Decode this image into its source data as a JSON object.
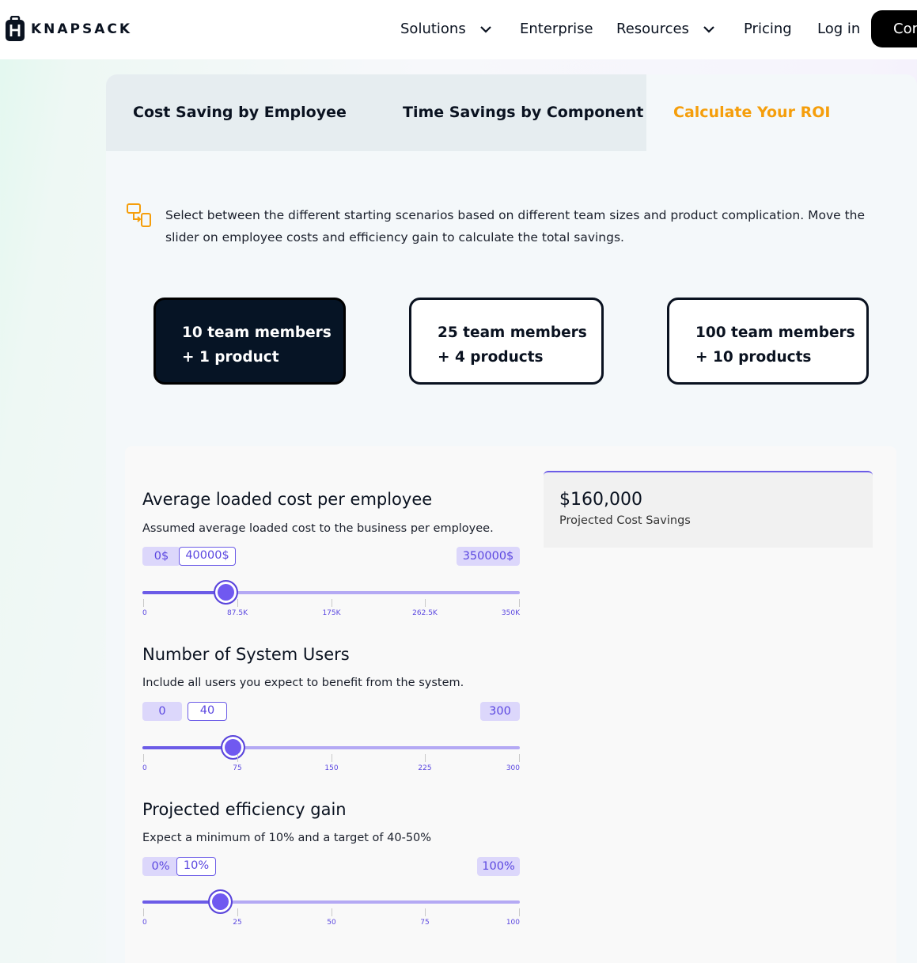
{
  "nav": {
    "brand": "KNAPSACK",
    "items": [
      {
        "label": "Solutions",
        "has_dropdown": true
      },
      {
        "label": "Enterprise",
        "has_dropdown": false
      },
      {
        "label": "Resources",
        "has_dropdown": true
      },
      {
        "label": "Pricing",
        "has_dropdown": false
      },
      {
        "label": "Log in",
        "has_dropdown": false
      }
    ],
    "cta_label": "Cor"
  },
  "tabs": [
    {
      "label": "Cost Saving by Employee",
      "active": false
    },
    {
      "label": "Time Savings by Component",
      "active": false
    },
    {
      "label": "Calculate Your ROI",
      "active": true
    }
  ],
  "intro": {
    "icon": "components-icon",
    "text": "Select between the different starting scenarios based on different team sizes and product complication. Move the slider on employee costs and efficiency gain to calculate the total savings."
  },
  "scenarios": [
    {
      "line1": "10 team members",
      "line2": "+ 1 product",
      "selected": true
    },
    {
      "line1": "25 team members",
      "line2": "+ 4 products",
      "selected": false
    },
    {
      "line1": "100 team members",
      "line2": "+ 10 products",
      "selected": false
    }
  ],
  "result": {
    "value": "$160,000",
    "label": "Projected Cost Savings"
  },
  "sliders": [
    {
      "title": "Average loaded cost per employee",
      "description": "Assumed average loaded cost to the business per employee.",
      "min_label": "0$",
      "current_label": "40000$",
      "max_label": "350000$",
      "min": 0,
      "max": 350000,
      "value": 40000,
      "ticks": [
        "0",
        "87.5K",
        "175K",
        "262.5K",
        "350K"
      ]
    },
    {
      "title": "Number of System Users",
      "description": "Include all users you expect to benefit from the system.",
      "min_label": "0",
      "current_label": "40",
      "max_label": "300",
      "min": 0,
      "max": 300,
      "value": 40,
      "ticks": [
        "0",
        "75",
        "150",
        "225",
        "300"
      ]
    },
    {
      "title": "Projected efficiency gain",
      "description": "Expect a minimum of 10% and a target of 40-50%",
      "min_label": "0%",
      "current_label": "10%",
      "max_label": "100%",
      "min": 0,
      "max": 100,
      "value": 10,
      "ticks": [
        "0",
        "25",
        "50",
        "75",
        "100"
      ]
    }
  ],
  "colors": {
    "accent": "#6c5ce7",
    "active_tab": "#f59e0b",
    "dark": "#061425"
  }
}
